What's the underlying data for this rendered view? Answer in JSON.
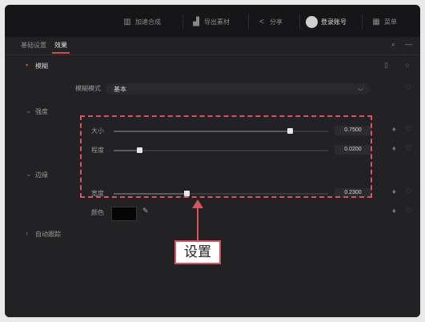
{
  "topbar": {
    "items": [
      {
        "icon": "image-icon",
        "label": "加速合成"
      },
      {
        "icon": "chart-icon",
        "label": "导出素材"
      },
      {
        "icon": "share-icon",
        "label": "分享"
      },
      {
        "icon": "avatar-icon",
        "label": "登录账号"
      },
      {
        "icon": "grid-icon",
        "label": "菜单"
      }
    ]
  },
  "tabs": {
    "items": [
      {
        "label": "基础设置"
      },
      {
        "label": "效果"
      }
    ],
    "tools": [
      "search-icon",
      "more-icon"
    ]
  },
  "effect_header": {
    "label": "模糊"
  },
  "mode": {
    "label": "模糊模式",
    "value": "基本"
  },
  "section_blur": {
    "label": "强度"
  },
  "slider_1": {
    "label": "大小",
    "value": "0.7500",
    "fill_fraction": 0.82
  },
  "slider_2": {
    "label": "程度",
    "value": "0.0200",
    "fill_fraction": 0.12
  },
  "section_edge": {
    "label": "边缘"
  },
  "slider_3": {
    "label": "宽度",
    "value": "0.2300",
    "fill_fraction": 0.34
  },
  "color_row": {
    "label": "颜色",
    "swatch": "#050505"
  },
  "section_auto": {
    "label": "自动跟踪"
  },
  "callout": {
    "label": "设置"
  },
  "colors": {
    "accent": "#d9535c",
    "panel": "#222224",
    "topbar": "#161618"
  }
}
